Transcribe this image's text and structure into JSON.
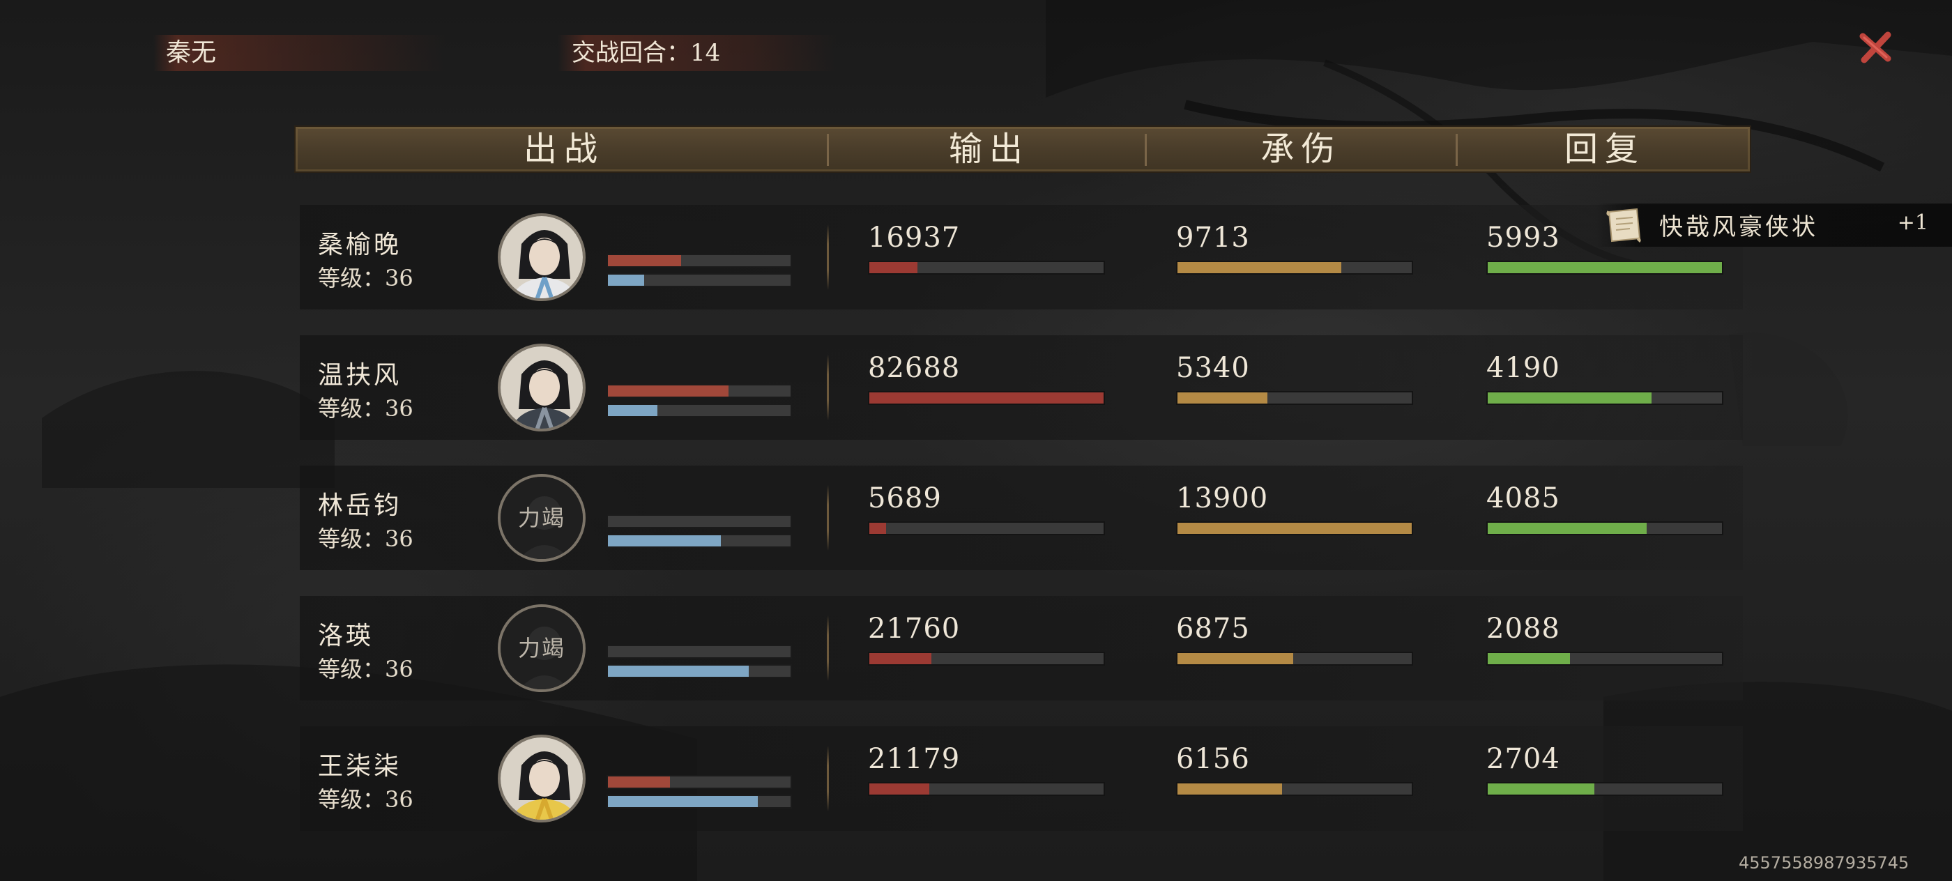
{
  "player_name": "秦无",
  "rounds_text": "交战回合：14",
  "header": {
    "sortie": "出战",
    "output": "输出",
    "damage_taken": "承伤",
    "healing": "回复"
  },
  "notice": {
    "text": "快哉风豪侠状",
    "count": "+1",
    "icon": "scroll-icon"
  },
  "footer_id": "4557558987935745",
  "colors": {
    "output": "#9c3a33",
    "taken": "#b48a45",
    "healing": "#6fae4a",
    "mini_red": "#a1483a",
    "mini_blue": "#7ea6c4"
  },
  "characters": [
    {
      "name": "桑榆晚",
      "level": "等级：36",
      "avatar": "female-portrait",
      "mini_red": 0.4,
      "mini_blue": 0.2,
      "output": "16937",
      "output_pct": 0.205,
      "taken": "9713",
      "taken_pct": 0.7,
      "healing": "5993",
      "healing_pct": 1.0
    },
    {
      "name": "温扶风",
      "level": "等级：36",
      "avatar": "male-portrait",
      "mini_red": 0.66,
      "mini_blue": 0.27,
      "output": "82688",
      "output_pct": 1.0,
      "taken": "5340",
      "taken_pct": 0.385,
      "healing": "4190",
      "healing_pct": 0.7
    },
    {
      "name": "林岳钧",
      "level": "等级：36",
      "avatar": "locked-portrait",
      "avatar_text": "力竭",
      "mini_red": 0.0,
      "mini_blue": 0.62,
      "output": "5689",
      "output_pct": 0.07,
      "taken": "13900",
      "taken_pct": 1.0,
      "healing": "4085",
      "healing_pct": 0.68
    },
    {
      "name": "洛瑛",
      "level": "等级：36",
      "avatar": "locked-portrait",
      "avatar_text": "力竭",
      "mini_red": 0.0,
      "mini_blue": 0.77,
      "output": "21760",
      "output_pct": 0.265,
      "taken": "6875",
      "taken_pct": 0.495,
      "healing": "2088",
      "healing_pct": 0.35
    },
    {
      "name": "王柒柒",
      "level": "等级：36",
      "avatar": "female-portrait-2",
      "mini_red": 0.34,
      "mini_blue": 0.82,
      "output": "21179",
      "output_pct": 0.255,
      "taken": "6156",
      "taken_pct": 0.445,
      "healing": "2704",
      "healing_pct": 0.455
    }
  ]
}
